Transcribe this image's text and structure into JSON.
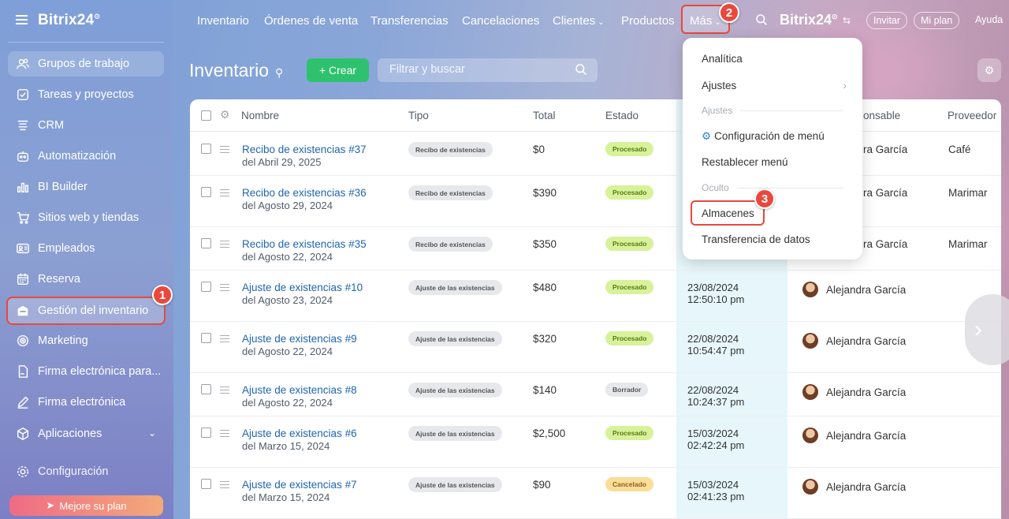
{
  "app": {
    "brand": "Bitrix24",
    "brand_mark": "⊙"
  },
  "sidebar": {
    "items": [
      {
        "label": "Grupos de trabajo",
        "icon": "groups-icon"
      },
      {
        "label": "Tareas y proyectos",
        "icon": "tasks-icon"
      },
      {
        "label": "CRM",
        "icon": "crm-icon"
      },
      {
        "label": "Automatización",
        "icon": "automation-icon"
      },
      {
        "label": "BI Builder",
        "icon": "bi-builder-icon"
      },
      {
        "label": "Sitios web y tiendas",
        "icon": "cart-icon"
      },
      {
        "label": "Empleados",
        "icon": "employees-icon"
      },
      {
        "label": "Reserva",
        "icon": "calendar-icon"
      },
      {
        "label": "Gestión del inventario",
        "icon": "inventory-icon"
      },
      {
        "label": "Marketing",
        "icon": "marketing-icon"
      },
      {
        "label": "Firma electrónica para...",
        "icon": "esign-doc-icon"
      },
      {
        "label": "Firma electrónica",
        "icon": "pen-icon"
      },
      {
        "label": "Aplicaciones",
        "icon": "apps-icon"
      }
    ],
    "settings_label": "Configuración",
    "upgrade_label": "Mejore su plan"
  },
  "topnav": {
    "items": [
      "Inventario",
      "Órdenes de venta",
      "Transferencias",
      "Cancelaciones",
      "Clientes",
      "Productos"
    ],
    "more_label": "Más",
    "invite_label": "Invitar",
    "plan_label": "Mi plan",
    "help_label": "Ayuda"
  },
  "page": {
    "title": "Inventario",
    "create_label": "+ Crear",
    "search_placeholder": "Filtrar y buscar"
  },
  "table": {
    "columns": {
      "name": "Nombre",
      "type": "Tipo",
      "total": "Total",
      "status": "Estado",
      "responsible": "onsable",
      "provider": "Proveedor"
    },
    "rows": [
      {
        "name": "Recibo de existencias #37",
        "sub": "del Abril 29, 2025",
        "type": "Recibo de existencias",
        "total": "$0",
        "status": "Procesado",
        "date": "",
        "time": "",
        "responsible": "ra García",
        "provider": "Café"
      },
      {
        "name": "Recibo de existencias #36",
        "sub": "del Agosto 29, 2024",
        "type": "Recibo de existencias",
        "total": "$390",
        "status": "Procesado",
        "date": "",
        "time": "",
        "responsible": "ra García",
        "provider": "Marimar"
      },
      {
        "name": "Recibo de existencias #35",
        "sub": "del Agosto 22, 2024",
        "type": "Recibo de existencias",
        "total": "$350",
        "status": "Procesado",
        "date": "",
        "time": "",
        "responsible": "ra García",
        "provider": "Marimar"
      },
      {
        "name": "Ajuste de existencias #10",
        "sub": "del Agosto 23, 2024",
        "type": "Ajuste de las existencias",
        "total": "$480",
        "status": "Procesado",
        "date": "23/08/2024",
        "time": "12:50:10 pm",
        "responsible": "Alejandra García",
        "provider": ""
      },
      {
        "name": "Ajuste de existencias #9",
        "sub": "del Agosto 22, 2024",
        "type": "Ajuste de las existencias",
        "total": "$320",
        "status": "Procesado",
        "date": "22/08/2024",
        "time": "10:54:47 pm",
        "responsible": "Alejandra García",
        "provider": ""
      },
      {
        "name": "Ajuste de existencias #8",
        "sub": "del Agosto 22, 2024",
        "type": "Ajuste de las existencias",
        "total": "$140",
        "status": "Borrador",
        "date": "22/08/2024",
        "time": "10:24:37 pm",
        "responsible": "Alejandra García",
        "provider": ""
      },
      {
        "name": "Ajuste de existencias #6",
        "sub": "del Marzo 15, 2024",
        "type": "Ajuste de las existencias",
        "total": "$2,500",
        "status": "Procesado",
        "date": "15/03/2024",
        "time": "02:42:24 pm",
        "responsible": "Alejandra García",
        "provider": ""
      },
      {
        "name": "Ajuste de existencias #7",
        "sub": "del Marzo 15, 2024",
        "type": "Ajuste de las existencias",
        "total": "$90",
        "status": "Cancelado",
        "date": "15/03/2024",
        "time": "02:41:23 pm",
        "responsible": "Alejandra García",
        "provider": ""
      }
    ]
  },
  "menu": {
    "analytics": "Analítica",
    "settings": "Ajustes",
    "settings_section": "Ajustes",
    "menu_config": "Configuración de menú",
    "reset_menu": "Restablecer menú",
    "hidden_section": "Oculto",
    "warehouses": "Almacenes",
    "data_transfer": "Transferencia de datos"
  },
  "callouts": [
    "1",
    "2",
    "3"
  ],
  "colors": {
    "accent_red": "#e8493c",
    "create_green": "#2fc26e",
    "link_blue": "#2066b0",
    "processed": "#d7f29a",
    "cancelled": "#fbdd9a"
  }
}
